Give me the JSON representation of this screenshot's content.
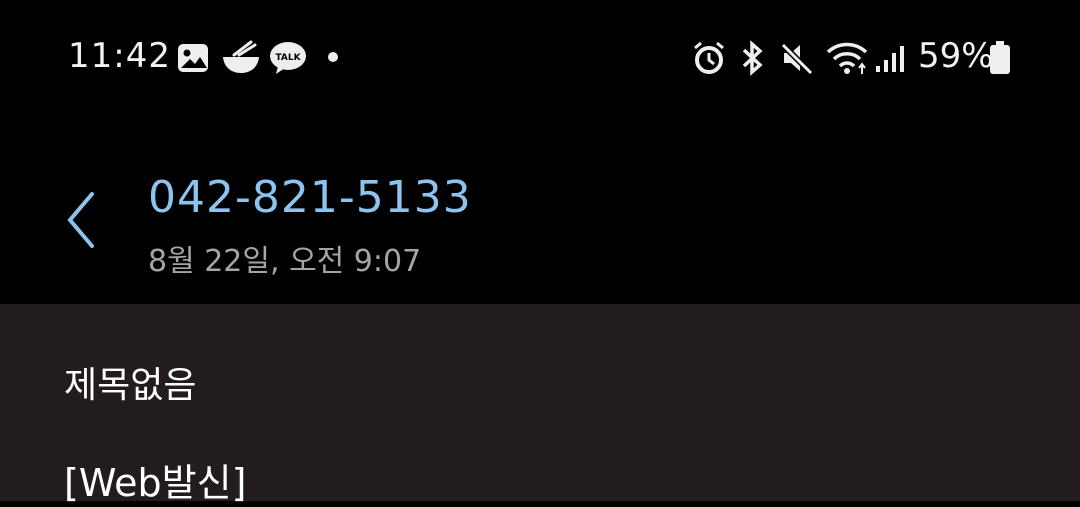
{
  "status_bar": {
    "time": "11:42",
    "left_icons": [
      "gallery-icon",
      "food-bowl-icon",
      "kakaotalk-icon",
      "more-dot-icon"
    ],
    "kakaotalk_label": "TALK",
    "right_icons": [
      "alarm-icon",
      "bluetooth-icon",
      "mute-icon",
      "wifi-icon",
      "signal-icon",
      "battery-icon"
    ],
    "battery": "59%"
  },
  "header": {
    "phone": "042-821-5133",
    "timestamp": "8월 22일, 오전 9:07"
  },
  "message": {
    "subject": "제목없음",
    "body": "[Web발신]"
  },
  "colors": {
    "accent": "#8cc4f0",
    "background": "#000000",
    "panel": "#221c1e"
  }
}
